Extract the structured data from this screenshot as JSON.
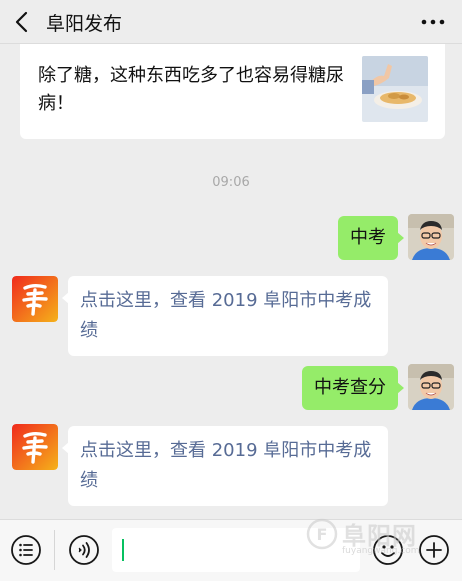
{
  "header": {
    "title": "阜阳发布",
    "back_icon": "chevron-left-icon",
    "more_icon": "more-dots-icon"
  },
  "article": {
    "title": "除了糖，这种东西吃多了也容易得糖尿病！"
  },
  "chat": {
    "time": "09:06",
    "messages": [
      {
        "from": "user",
        "text": "中考"
      },
      {
        "from": "bot",
        "text": "点击这里，查看 2019 阜阳市中考成绩"
      },
      {
        "from": "user",
        "text": "中考查分"
      },
      {
        "from": "bot",
        "text": "点击这里，查看 2019 阜阳市中考成绩"
      }
    ]
  },
  "input_bar": {
    "menu_icon": "menu-list-icon",
    "voice_icon": "voice-icon",
    "emoji_icon": "emoji-icon",
    "plus_icon": "plus-icon"
  },
  "watermark": {
    "text": "阜阳网",
    "sub": "fuyangwang.com"
  },
  "colors": {
    "background": "#ededed",
    "outgoing_bubble": "#95ec69",
    "link_text": "#576b95",
    "brand_red": "#e8231b"
  }
}
